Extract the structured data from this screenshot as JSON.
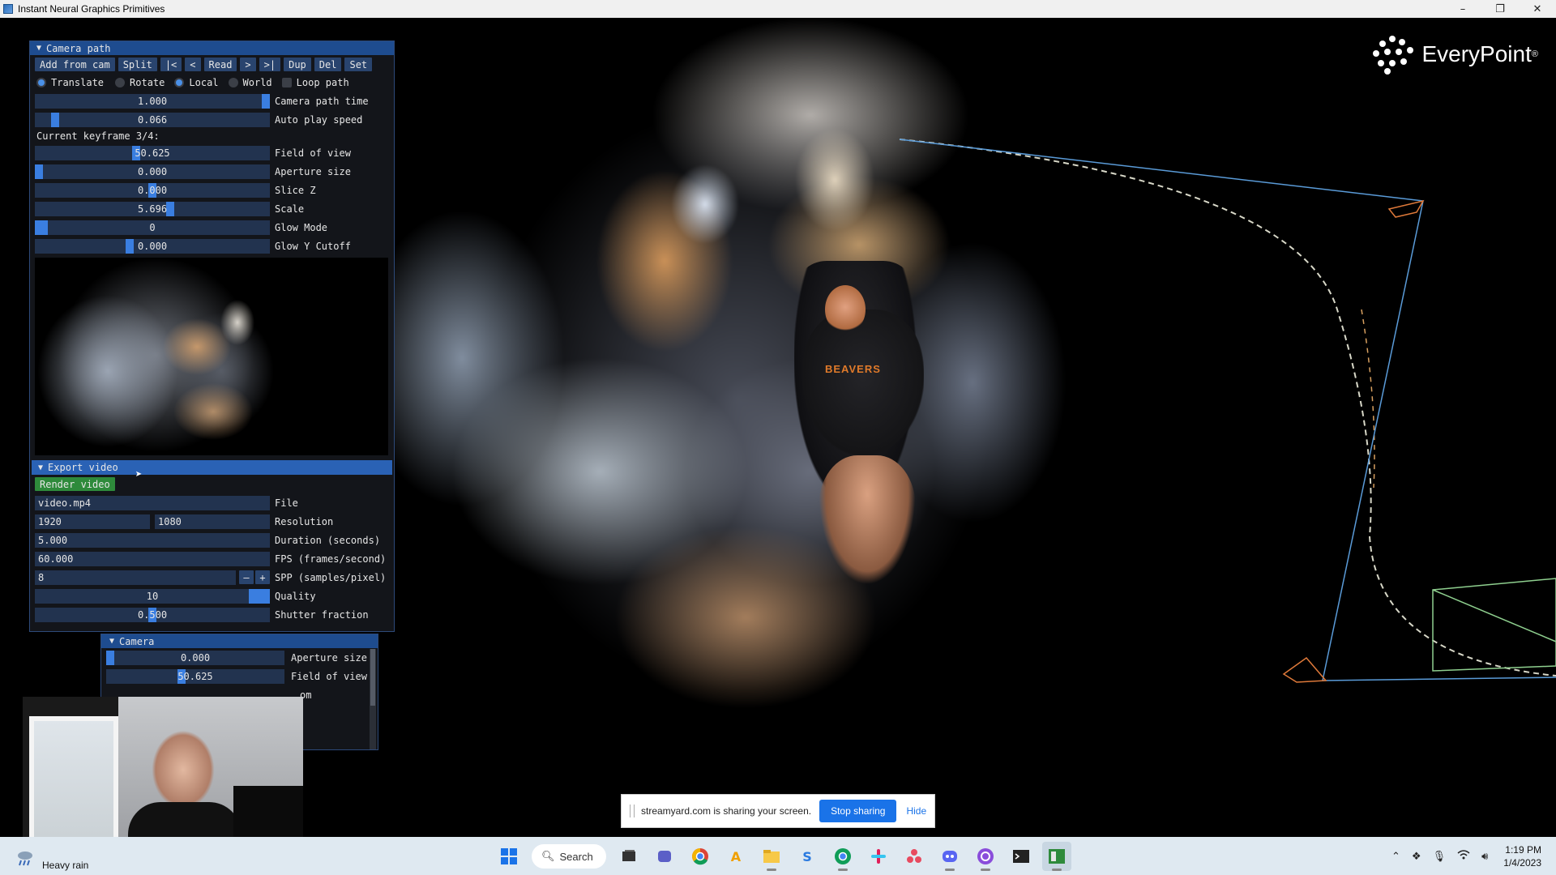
{
  "window": {
    "title": "Instant Neural Graphics Primitives",
    "buttons": [
      "–",
      "❐",
      "✕"
    ]
  },
  "logo": {
    "text": "EveryPoint",
    "mark": "®"
  },
  "camera_path_panel": {
    "title": "Camera path",
    "buttons": [
      "Add from cam",
      "Split",
      "|<",
      "<",
      "Read",
      ">",
      ">|",
      "Dup",
      "Del",
      "Set"
    ],
    "radios": [
      {
        "label": "Translate",
        "selected": true
      },
      {
        "label": "Rotate",
        "selected": false
      },
      {
        "label": "Local",
        "selected": true
      },
      {
        "label": "World",
        "selected": false
      }
    ],
    "loop_path": {
      "label": "Loop path",
      "checked": false
    },
    "camera_path_time": {
      "value": "1.000",
      "label": "Camera path time",
      "fraction": 1.0
    },
    "auto_play_speed": {
      "value": "0.066",
      "label": "Auto play speed",
      "fraction": 0.066
    },
    "current_keyframe": "Current keyframe 3/4:",
    "params": [
      {
        "value": "50.625",
        "label": "Field of view",
        "fraction": 0.42
      },
      {
        "value": "0.000",
        "label": "Aperture size",
        "fraction": 0.0
      },
      {
        "value": "0.000",
        "label": "Slice Z",
        "fraction": 0.5
      },
      {
        "value": "5.696",
        "label": "Scale",
        "fraction": 0.57
      },
      {
        "value": "0",
        "label": "Glow Mode",
        "fraction": 0.0
      },
      {
        "value": "0.000",
        "label": "Glow Y Cutoff",
        "fraction": 0.4
      }
    ]
  },
  "export_video_panel": {
    "title": "Export video",
    "render_button": "Render video",
    "file": {
      "value": "video.mp4",
      "label": "File"
    },
    "resolution": {
      "width": "1920",
      "height": "1080",
      "label": "Resolution"
    },
    "duration": {
      "value": "5.000",
      "label": "Duration (seconds)"
    },
    "fps": {
      "value": "60.000",
      "label": "FPS (frames/second)"
    },
    "spp": {
      "value": "8",
      "label": "SPP (samples/pixel)",
      "minus": "–",
      "plus": "+"
    },
    "quality": {
      "value": "10",
      "label": "Quality",
      "fraction": 1.0
    },
    "shutter_fraction": {
      "value": "0.500",
      "label": "Shutter fraction",
      "fraction": 0.5
    }
  },
  "camera_panel": {
    "title": "Camera",
    "aperture_size": {
      "value": "0.000",
      "label": "Aperture size",
      "fraction": 0.0
    },
    "field_of_view": {
      "value": "50.625",
      "label": "Field of view",
      "fraction": 0.42
    },
    "partial_label": "om"
  },
  "scene": {
    "shirt_text": "BEAVERS"
  },
  "share_bar": {
    "message": "streamyard.com is sharing your screen.",
    "stop_button": "Stop sharing",
    "hide_button": "Hide"
  },
  "taskbar": {
    "weather": "Heavy rain",
    "search_label": "Search",
    "time": "1:19 PM",
    "date": "1/4/2023",
    "pinned": [
      "start-icon",
      "search",
      "task-view-icon",
      "teams-icon",
      "chrome-icon",
      "acrobat-icon",
      "file-explorer-icon",
      "streamyard-icon",
      "chrome-profile-icon",
      "slack-icon",
      "cluster-icon",
      "discord-icon",
      "obs-icon",
      "terminal-icon",
      "ngp-app-icon"
    ],
    "tray": [
      "chevron-up-icon",
      "dropbox-icon",
      "microphone-icon",
      "wifi-icon",
      "speaker-icon"
    ]
  },
  "colors": {
    "imgui_header": "#1e4c8f",
    "imgui_button": "#29446e",
    "imgui_slider": "#22334f",
    "imgui_grab": "#3a7ee0",
    "render_button": "#2e8a3b",
    "path_spline": "#d8d8c8",
    "path_lines": "#5a9bd8",
    "frustum_orange": "#e07a3a",
    "frustum_green": "#8fd08f",
    "share_blue": "#1a73e8"
  }
}
